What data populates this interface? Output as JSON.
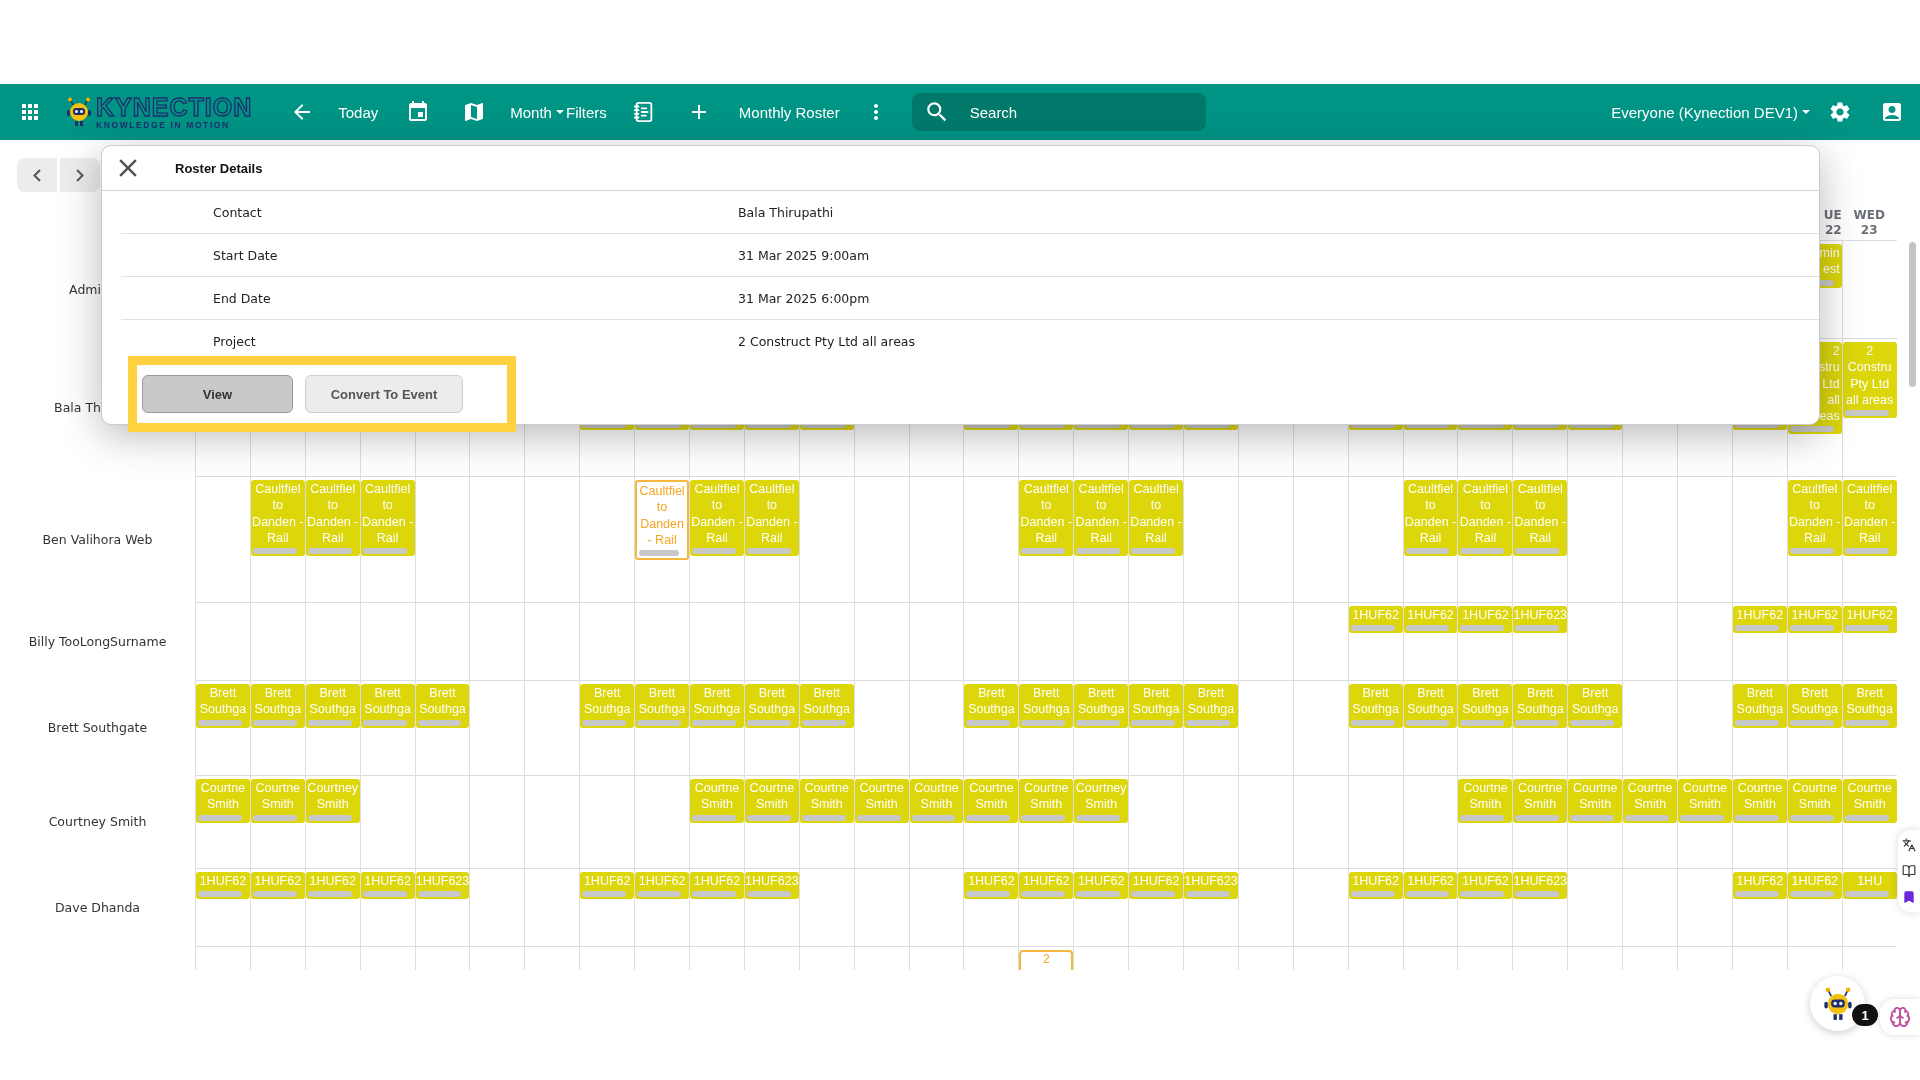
{
  "header": {
    "logo": {
      "title": "KYNECTION",
      "tagline": "KNOWLEDGE IN MOTION"
    },
    "today": "Today",
    "view": "Month",
    "filters": "Filters",
    "roster": "Monthly Roster",
    "search": {
      "placeholder": "Search"
    },
    "scope": "Everyone (Kynection DEV1)"
  },
  "calendar": {
    "day_headers": [
      {
        "kind": "empty"
      },
      {
        "kind": "empty"
      },
      {
        "kind": "empty"
      },
      {
        "kind": "empty"
      },
      {
        "kind": "empty"
      },
      {
        "kind": "empty"
      },
      {
        "kind": "empty"
      },
      {
        "kind": "empty"
      },
      {
        "kind": "empty"
      },
      {
        "kind": "empty"
      },
      {
        "kind": "empty"
      },
      {
        "kind": "empty"
      },
      {
        "kind": "empty"
      },
      {
        "kind": "empty"
      },
      {
        "kind": "empty"
      },
      {
        "kind": "empty"
      },
      {
        "kind": "empty"
      },
      {
        "kind": "empty"
      },
      {
        "kind": "empty"
      },
      {
        "kind": "empty"
      },
      {
        "kind": "empty"
      },
      {
        "kind": "empty"
      },
      {
        "kind": "empty"
      },
      {
        "kind": "empty"
      },
      {
        "kind": "empty"
      },
      {
        "kind": "empty"
      },
      {
        "kind": "empty"
      },
      {
        "kind": "empty"
      },
      {
        "kind": "empty"
      },
      {
        "kind": "partial",
        "day": "UE",
        "date": "22"
      },
      {
        "kind": "day",
        "day": "WED",
        "date": "23"
      }
    ],
    "rows": [
      {
        "name": "Admi",
        "label_cut": true,
        "cells": [
          {
            "kind": "empty"
          },
          {
            "kind": "empty"
          },
          {
            "kind": "empty"
          },
          {
            "kind": "empty"
          },
          {
            "kind": "empty"
          },
          {
            "kind": "empty"
          },
          {
            "kind": "empty"
          },
          {
            "kind": "empty"
          },
          {
            "kind": "empty"
          },
          {
            "kind": "empty"
          },
          {
            "kind": "empty"
          },
          {
            "kind": "empty"
          },
          {
            "kind": "empty"
          },
          {
            "kind": "empty"
          },
          {
            "kind": "empty"
          },
          {
            "kind": "empty"
          },
          {
            "kind": "empty"
          },
          {
            "kind": "empty"
          },
          {
            "kind": "empty"
          },
          {
            "kind": "empty"
          },
          {
            "kind": "empty"
          },
          {
            "kind": "empty"
          },
          {
            "kind": "empty"
          },
          {
            "kind": "empty"
          },
          {
            "kind": "empty"
          },
          {
            "kind": "empty"
          },
          {
            "kind": "empty"
          },
          {
            "kind": "empty"
          },
          {
            "kind": "empty"
          },
          {
            "kind": "partial",
            "text": "min est",
            "selected": false
          },
          {
            "kind": "empty"
          }
        ]
      },
      {
        "name": "Bala Th",
        "label_cut": true,
        "cells": [
          {
            "kind": "empty"
          },
          {
            "kind": "empty"
          },
          {
            "kind": "empty"
          },
          {
            "kind": "empty"
          },
          {
            "kind": "empty"
          },
          {
            "kind": "empty"
          },
          {
            "kind": "empty"
          },
          {
            "kind": "covered"
          },
          {
            "kind": "covered"
          },
          {
            "kind": "covered"
          },
          {
            "kind": "covered"
          },
          {
            "kind": "covered"
          },
          {
            "kind": "empty"
          },
          {
            "kind": "empty"
          },
          {
            "kind": "covered"
          },
          {
            "kind": "covered"
          },
          {
            "kind": "covered"
          },
          {
            "kind": "covered"
          },
          {
            "kind": "covered"
          },
          {
            "kind": "empty"
          },
          {
            "kind": "empty"
          },
          {
            "kind": "covered"
          },
          {
            "kind": "covered"
          },
          {
            "kind": "covered"
          },
          {
            "kind": "covered"
          },
          {
            "kind": "covered"
          },
          {
            "kind": "empty"
          },
          {
            "kind": "empty"
          },
          {
            "kind": "covered"
          },
          {
            "kind": "partial",
            "text": "2 stru Ltd all eas",
            "selected": false
          },
          {
            "kind": "event",
            "text": "2 Constru Pty Ltd all areas",
            "selected": false
          }
        ]
      },
      {
        "name": "Ben Valihora Web",
        "label_cut": false,
        "cells": [
          {
            "kind": "empty"
          },
          {
            "kind": "event",
            "text": "Caultfiel to Danden - Rail",
            "selected": false
          },
          {
            "kind": "event",
            "text": "Caultfiel to Danden - Rail",
            "selected": false
          },
          {
            "kind": "event",
            "text": "Caultfiel to Danden - Rail",
            "selected": false
          },
          {
            "kind": "empty"
          },
          {
            "kind": "empty"
          },
          {
            "kind": "empty"
          },
          {
            "kind": "empty"
          },
          {
            "kind": "event",
            "text": "Caultfiel to Danden - Rail",
            "selected": true
          },
          {
            "kind": "event",
            "text": "Caultfiel to Danden - Rail",
            "selected": false
          },
          {
            "kind": "event",
            "text": "Caultfiel to Danden - Rail",
            "selected": false
          },
          {
            "kind": "empty"
          },
          {
            "kind": "empty"
          },
          {
            "kind": "empty"
          },
          {
            "kind": "empty"
          },
          {
            "kind": "event",
            "text": "Caultfiel to Danden - Rail",
            "selected": false
          },
          {
            "kind": "event",
            "text": "Caultfiel to Danden - Rail",
            "selected": false
          },
          {
            "kind": "event",
            "text": "Caultfiel to Danden - Rail",
            "selected": false
          },
          {
            "kind": "empty"
          },
          {
            "kind": "empty"
          },
          {
            "kind": "empty"
          },
          {
            "kind": "empty"
          },
          {
            "kind": "event",
            "text": "Caultfiel to Danden - Rail",
            "selected": false
          },
          {
            "kind": "event",
            "text": "Caultfiel to Danden - Rail",
            "selected": false
          },
          {
            "kind": "event",
            "text": "Caultfiel to Danden - Rail",
            "selected": false
          },
          {
            "kind": "empty"
          },
          {
            "kind": "empty"
          },
          {
            "kind": "empty"
          },
          {
            "kind": "empty"
          },
          {
            "kind": "event",
            "text": "Caultfiel to Danden - Rail",
            "selected": false
          },
          {
            "kind": "event",
            "text": "Caultfiel to Danden - Rail",
            "selected": false
          }
        ]
      },
      {
        "name": "Billy TooLongSurname",
        "label_cut": false,
        "cells": [
          {
            "kind": "empty"
          },
          {
            "kind": "empty"
          },
          {
            "kind": "empty"
          },
          {
            "kind": "empty"
          },
          {
            "kind": "empty"
          },
          {
            "kind": "empty"
          },
          {
            "kind": "empty"
          },
          {
            "kind": "empty"
          },
          {
            "kind": "empty"
          },
          {
            "kind": "empty"
          },
          {
            "kind": "empty"
          },
          {
            "kind": "empty"
          },
          {
            "kind": "empty"
          },
          {
            "kind": "empty"
          },
          {
            "kind": "empty"
          },
          {
            "kind": "empty"
          },
          {
            "kind": "empty"
          },
          {
            "kind": "empty"
          },
          {
            "kind": "empty"
          },
          {
            "kind": "empty"
          },
          {
            "kind": "empty"
          },
          {
            "kind": "event",
            "text": "1HUF62",
            "selected": false
          },
          {
            "kind": "event",
            "text": "1HUF62",
            "selected": false
          },
          {
            "kind": "event",
            "text": "1HUF62",
            "selected": false
          },
          {
            "kind": "event",
            "text": "1HUF623",
            "selected": false
          },
          {
            "kind": "empty"
          },
          {
            "kind": "empty"
          },
          {
            "kind": "empty"
          },
          {
            "kind": "event",
            "text": "1HUF62",
            "selected": false
          },
          {
            "kind": "event",
            "text": "1HUF62",
            "selected": false
          },
          {
            "kind": "event",
            "text": "1HUF62",
            "selected": false
          }
        ]
      },
      {
        "name": "Brett Southgate",
        "label_cut": false,
        "cells": [
          {
            "kind": "event",
            "text": "Brett Southga",
            "selected": false
          },
          {
            "kind": "event",
            "text": "Brett Southga",
            "selected": false
          },
          {
            "kind": "event",
            "text": "Brett Southga",
            "selected": false
          },
          {
            "kind": "event",
            "text": "Brett Southga",
            "selected": false
          },
          {
            "kind": "event",
            "text": "Brett Southga",
            "selected": false
          },
          {
            "kind": "empty"
          },
          {
            "kind": "empty"
          },
          {
            "kind": "event",
            "text": "Brett Southga",
            "selected": false
          },
          {
            "kind": "event",
            "text": "Brett Southga",
            "selected": false
          },
          {
            "kind": "event",
            "text": "Brett Southga",
            "selected": false
          },
          {
            "kind": "event",
            "text": "Brett Southga",
            "selected": false
          },
          {
            "kind": "event",
            "text": "Brett Southga",
            "selected": false
          },
          {
            "kind": "empty"
          },
          {
            "kind": "empty"
          },
          {
            "kind": "event",
            "text": "Brett Southga",
            "selected": false
          },
          {
            "kind": "event",
            "text": "Brett Southga",
            "selected": false
          },
          {
            "kind": "event",
            "text": "Brett Southga",
            "selected": false
          },
          {
            "kind": "event",
            "text": "Brett Southga",
            "selected": false
          },
          {
            "kind": "event",
            "text": "Brett Southga",
            "selected": false
          },
          {
            "kind": "empty"
          },
          {
            "kind": "empty"
          },
          {
            "kind": "event",
            "text": "Brett Southga",
            "selected": false
          },
          {
            "kind": "event",
            "text": "Brett Southga",
            "selected": false
          },
          {
            "kind": "event",
            "text": "Brett Southga",
            "selected": false
          },
          {
            "kind": "event",
            "text": "Brett Southga",
            "selected": false
          },
          {
            "kind": "event",
            "text": "Brett Southga",
            "selected": false
          },
          {
            "kind": "empty"
          },
          {
            "kind": "empty"
          },
          {
            "kind": "event",
            "text": "Brett Southga",
            "selected": false
          },
          {
            "kind": "event",
            "text": "Brett Southga",
            "selected": false
          },
          {
            "kind": "event",
            "text": "Brett Southga",
            "selected": false
          }
        ]
      },
      {
        "name": "Courtney Smith",
        "label_cut": false,
        "cells": [
          {
            "kind": "event",
            "text": "Courtne Smith",
            "selected": false
          },
          {
            "kind": "event",
            "text": "Courtne Smith",
            "selected": false
          },
          {
            "kind": "event",
            "text": "Courtney Smith",
            "selected": false
          },
          {
            "kind": "empty"
          },
          {
            "kind": "empty"
          },
          {
            "kind": "empty"
          },
          {
            "kind": "empty"
          },
          {
            "kind": "empty"
          },
          {
            "kind": "empty"
          },
          {
            "kind": "event",
            "text": "Courtne Smith",
            "selected": false
          },
          {
            "kind": "event",
            "text": "Courtne Smith",
            "selected": false
          },
          {
            "kind": "event",
            "text": "Courtne Smith",
            "selected": false
          },
          {
            "kind": "event",
            "text": "Courtne Smith",
            "selected": false
          },
          {
            "kind": "event",
            "text": "Courtne Smith",
            "selected": false
          },
          {
            "kind": "event",
            "text": "Courtne Smith",
            "selected": false
          },
          {
            "kind": "event",
            "text": "Courtne Smith",
            "selected": false
          },
          {
            "kind": "event",
            "text": "Courtney Smith",
            "selected": false
          },
          {
            "kind": "empty"
          },
          {
            "kind": "empty"
          },
          {
            "kind": "empty"
          },
          {
            "kind": "empty"
          },
          {
            "kind": "empty"
          },
          {
            "kind": "empty"
          },
          {
            "kind": "event",
            "text": "Courtne Smith",
            "selected": false
          },
          {
            "kind": "event",
            "text": "Courtne Smith",
            "selected": false
          },
          {
            "kind": "event",
            "text": "Courtne Smith",
            "selected": false
          },
          {
            "kind": "event",
            "text": "Courtne Smith",
            "selected": false
          },
          {
            "kind": "event",
            "text": "Courtne Smith",
            "selected": false
          },
          {
            "kind": "event",
            "text": "Courtne Smith",
            "selected": false
          },
          {
            "kind": "event",
            "text": "Courtne Smith",
            "selected": false
          },
          {
            "kind": "event",
            "text": "Courtne Smith",
            "selected": false
          }
        ]
      },
      {
        "name": "Dave Dhanda",
        "label_cut": false,
        "cells": [
          {
            "kind": "event",
            "text": "1HUF62",
            "selected": false
          },
          {
            "kind": "event",
            "text": "1HUF62",
            "selected": false
          },
          {
            "kind": "event",
            "text": "1HUF62",
            "selected": false
          },
          {
            "kind": "event",
            "text": "1HUF62",
            "selected": false
          },
          {
            "kind": "event",
            "text": "1HUF623",
            "selected": false
          },
          {
            "kind": "empty"
          },
          {
            "kind": "empty"
          },
          {
            "kind": "event",
            "text": "1HUF62",
            "selected": false
          },
          {
            "kind": "event",
            "text": "1HUF62",
            "selected": false
          },
          {
            "kind": "event",
            "text": "1HUF62",
            "selected": false
          },
          {
            "kind": "event",
            "text": "1HUF623",
            "selected": false
          },
          {
            "kind": "empty"
          },
          {
            "kind": "empty"
          },
          {
            "kind": "empty"
          },
          {
            "kind": "event",
            "text": "1HUF62",
            "selected": false
          },
          {
            "kind": "event",
            "text": "1HUF62",
            "selected": false
          },
          {
            "kind": "event",
            "text": "1HUF62",
            "selected": false
          },
          {
            "kind": "event",
            "text": "1HUF62",
            "selected": false
          },
          {
            "kind": "event",
            "text": "1HUF623",
            "selected": false
          },
          {
            "kind": "empty"
          },
          {
            "kind": "empty"
          },
          {
            "kind": "event",
            "text": "1HUF62",
            "selected": false
          },
          {
            "kind": "event",
            "text": "1HUF62",
            "selected": false
          },
          {
            "kind": "event",
            "text": "1HUF62",
            "selected": false
          },
          {
            "kind": "event",
            "text": "1HUF623",
            "selected": false
          },
          {
            "kind": "empty"
          },
          {
            "kind": "empty"
          },
          {
            "kind": "empty"
          },
          {
            "kind": "event",
            "text": "1HUF62",
            "selected": false
          },
          {
            "kind": "event",
            "text": "1HUF62",
            "selected": false
          },
          {
            "kind": "event",
            "text": "1HU",
            "selected": false
          }
        ]
      },
      {
        "cells": [
          {
            "kind": "empty"
          },
          {
            "kind": "empty"
          },
          {
            "kind": "empty"
          },
          {
            "kind": "empty"
          },
          {
            "kind": "empty"
          },
          {
            "kind": "empty"
          },
          {
            "kind": "empty"
          },
          {
            "kind": "empty"
          },
          {
            "kind": "empty"
          },
          {
            "kind": "empty"
          },
          {
            "kind": "empty"
          },
          {
            "kind": "empty"
          },
          {
            "kind": "empty"
          },
          {
            "kind": "empty"
          },
          {
            "kind": "empty"
          },
          {
            "kind": "more",
            "text": "2"
          },
          {
            "kind": "empty"
          },
          {
            "kind": "empty"
          },
          {
            "kind": "empty"
          },
          {
            "kind": "empty"
          },
          {
            "kind": "empty"
          },
          {
            "kind": "empty"
          },
          {
            "kind": "empty"
          },
          {
            "kind": "empty"
          },
          {
            "kind": "empty"
          },
          {
            "kind": "empty"
          },
          {
            "kind": "empty"
          },
          {
            "kind": "empty"
          },
          {
            "kind": "empty"
          },
          {
            "kind": "empty"
          },
          {
            "kind": "empty"
          }
        ]
      }
    ]
  },
  "dialog": {
    "title": "Roster Details",
    "fields": [
      {
        "label": "Contact",
        "value": "Bala Thirupathi"
      },
      {
        "label": "Start Date",
        "value": "31 Mar 2025 9:00am"
      },
      {
        "label": "End Date",
        "value": "31 Mar 2025 6:00pm"
      },
      {
        "label": "Project",
        "value": "2 Construct Pty Ltd all areas"
      }
    ],
    "buttons": [
      {
        "label": "View",
        "kind": "primary"
      },
      {
        "label": "Convert To Event",
        "kind": "secondary"
      }
    ]
  },
  "widgets": {
    "badge": "1"
  }
}
